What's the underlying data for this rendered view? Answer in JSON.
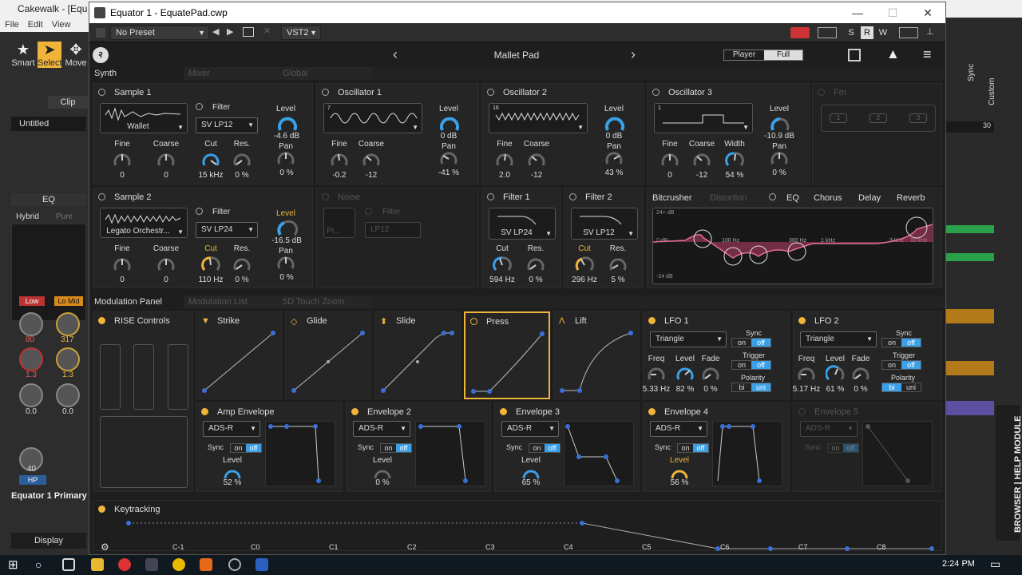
{
  "host": {
    "title": "Cakewalk - [Equ",
    "menu": "File  Edit  View",
    "tools": [
      "Smart",
      "Select",
      "Move"
    ],
    "clip_tab": "Clip",
    "untitled": "Untitled",
    "eq": "EQ",
    "hybrid": "Hybrid",
    "pure": "Pure",
    "low": "Low",
    "lomid": "Lo Mid",
    "v1": "80",
    "v2": "317",
    "v3": "1.3",
    "v4": "1.3",
    "v5": "0.0",
    "v6": "0.0",
    "v7": "40",
    "hp": "HP",
    "track": "Equator 1 Primary",
    "display": "Display",
    "sidebar_label": "BROWSER | HELP MODULE",
    "sync": "Sync",
    "custom": "Custom",
    "num30": "30"
  },
  "plugin": {
    "title": "Equator 1 - EquatePad.cwp",
    "preset": "No Preset",
    "vst": "VST2",
    "s": "S",
    "r": "R",
    "w": "W"
  },
  "eq": {
    "patch": "Mallet Pad",
    "player": "Player",
    "full": "Full",
    "tabs": [
      "Synth",
      "Mixer",
      "Global"
    ],
    "sample1": {
      "title": "Sample 1",
      "wave": "Wallet",
      "filter": "Filter",
      "ftype": "SV LP12",
      "level": "Level",
      "level_val": "-4.6 dB",
      "pan": "Pan",
      "pan_val": "0 %",
      "fine": "Fine",
      "fine_val": "0",
      "coarse": "Coarse",
      "coarse_val": "0",
      "cut": "Cut",
      "cut_val": "15 kHz",
      "res": "Res.",
      "res_val": "0 %"
    },
    "osc1": {
      "title": "Oscillator 1",
      "level": "Level",
      "level_val": "0 dB",
      "pan": "Pan",
      "pan_val": "-41 %",
      "fine": "Fine",
      "fine_val": "-0.2",
      "coarse": "Coarse",
      "coarse_val": "-12",
      "num": "7"
    },
    "osc2": {
      "title": "Oscillator 2",
      "level": "Level",
      "level_val": "0 dB",
      "pan": "Pan",
      "pan_val": "43 %",
      "fine": "Fine",
      "fine_val": "2.0",
      "coarse": "Coarse",
      "coarse_val": "-12",
      "num": "16"
    },
    "osc3": {
      "title": "Oscillator 3",
      "level": "Level",
      "level_val": "-10.9 dB",
      "pan": "Pan",
      "pan_val": "0 %",
      "fine": "Fine",
      "fine_val": "0",
      "coarse": "Coarse",
      "coarse_val": "-12",
      "width": "Width",
      "width_val": "54 %",
      "num": "1"
    },
    "fm": {
      "title": "Fm",
      "n1": "1",
      "n2": "2",
      "n3": "3"
    },
    "sample2": {
      "title": "Sample 2",
      "wave": "Legato Orchestr...",
      "filter": "Filter",
      "ftype": "SV LP24",
      "level": "Level",
      "level_val": "-16.5 dB",
      "pan": "Pan",
      "pan_val": "0 %",
      "fine": "Fine",
      "fine_val": "0",
      "coarse": "Coarse",
      "coarse_val": "0",
      "cut": "Cut",
      "cut_val": "110 Hz",
      "res": "Res.",
      "res_val": "0 %"
    },
    "noise": {
      "title": "Noise",
      "filter": "Filter",
      "ftype": "LP12",
      "wave": "Pi..."
    },
    "filter1": {
      "title": "Filter 1",
      "ftype": "SV LP24",
      "cut": "Cut",
      "cut_val": "594 Hz",
      "res": "Res.",
      "res_val": "0 %"
    },
    "filter2": {
      "title": "Filter 2",
      "ftype": "SV LP12",
      "cut": "Cut",
      "cut_val": "296 Hz",
      "res": "Res.",
      "res_val": "5 %"
    },
    "fx": {
      "tabs": [
        "Bitcrusher",
        "Distortion",
        "EQ",
        "Chorus",
        "Delay",
        "Reverb"
      ],
      "db_top": "24+ dB",
      "db_mid": "0 dB",
      "db_bot": "-24 dB",
      "f1": "100 Hz",
      "f2": "300 Hz",
      "f3": "1 kHz",
      "f4": "3 kHz",
      "f5": "10 kHz"
    },
    "mod_tabs": [
      "Modulation Panel",
      "Modulation List",
      "5D Touch Zoom"
    ],
    "rise": {
      "title": "RISE Controls"
    },
    "curves": [
      {
        "title": "Strike"
      },
      {
        "title": "Glide"
      },
      {
        "title": "Slide"
      },
      {
        "title": "Press"
      },
      {
        "title": "Lift"
      }
    ],
    "lfo1": {
      "title": "LFO 1",
      "shape": "Triangle",
      "sync": "Sync",
      "trigger": "Trigger",
      "polarity": "Polarity",
      "on": "on",
      "off": "off",
      "bi": "bi",
      "uni": "uni",
      "freq": "Freq",
      "freq_val": "5.33 Hz",
      "level": "Level",
      "level_val": "82 %",
      "fade": "Fade",
      "fade_val": "0 %"
    },
    "lfo2": {
      "title": "LFO 2",
      "shape": "Triangle",
      "sync": "Sync",
      "trigger": "Trigger",
      "polarity": "Polarity",
      "on": "on",
      "off": "off",
      "bi": "bi",
      "uni": "uni",
      "freq": "Freq",
      "freq_val": "5.17 Hz",
      "level": "Level",
      "level_val": "61 %",
      "fade": "Fade",
      "fade_val": "0 %"
    },
    "envs": [
      {
        "title": "Amp Envelope",
        "mode": "ADS-R",
        "sync": "Sync",
        "on": "on",
        "off": "off",
        "level": "Level",
        "level_val": "52 %"
      },
      {
        "title": "Envelope 2",
        "mode": "ADS-R",
        "sync": "Sync",
        "on": "on",
        "off": "off",
        "level": "Level",
        "level_val": "0 %"
      },
      {
        "title": "Envelope 3",
        "mode": "ADS-R",
        "sync": "Sync",
        "on": "on",
        "off": "off",
        "level": "Level",
        "level_val": "65 %"
      },
      {
        "title": "Envelope 4",
        "mode": "ADS-R",
        "sync": "Sync",
        "on": "on",
        "off": "off",
        "level": "Level",
        "level_val": "56 %"
      },
      {
        "title": "Envelope 5",
        "mode": "ADS-R",
        "sync": "Sync",
        "on": "on",
        "off": "off"
      }
    ],
    "keytracking": {
      "title": "Keytracking",
      "keys": [
        "C-1",
        "C0",
        "C1",
        "C2",
        "C3",
        "C4",
        "C5",
        "C6",
        "C7",
        "C8"
      ]
    }
  },
  "taskbar": {
    "time": "2:24 PM"
  },
  "colors": {
    "accent": "#3aa0e8",
    "warm": "#f0b43a",
    "eqcurve": "#c0406a"
  }
}
